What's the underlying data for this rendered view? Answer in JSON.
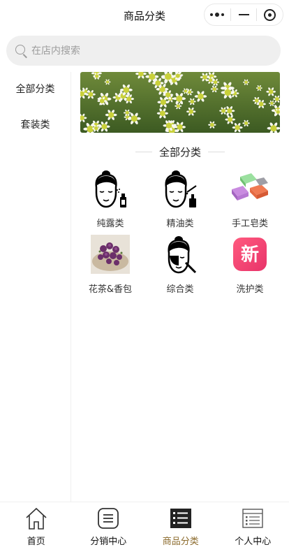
{
  "navbar": {
    "title": "商品分类"
  },
  "search": {
    "placeholder": "在店内搜索"
  },
  "categories": [
    {
      "label": "全部分类"
    },
    {
      "label": "套装类"
    }
  ],
  "section": {
    "title": "全部分类"
  },
  "products": [
    {
      "label": "纯露类",
      "icon": "woman-face-spray-icon"
    },
    {
      "label": "精油类",
      "icon": "woman-face-dropper-icon"
    },
    {
      "label": "手工皂类",
      "icon": "handmade-soap-image"
    },
    {
      "label": "花茶&香包",
      "icon": "flower-tea-image"
    },
    {
      "label": "综合类",
      "icon": "woman-face-mask-icon"
    },
    {
      "label": "洗护类",
      "icon": "new-badge-icon"
    }
  ],
  "tabbar": {
    "items": [
      {
        "label": "首页",
        "icon": "home-icon"
      },
      {
        "label": "分销中心",
        "icon": "list-icon"
      },
      {
        "label": "商品分类",
        "icon": "category-icon",
        "active": true
      },
      {
        "label": "个人中心",
        "icon": "profile-icon"
      }
    ],
    "active_color": "#8b6a2b"
  },
  "colors": {
    "new_badge": "#f0456e",
    "banner_flower": "#c9d13a"
  }
}
